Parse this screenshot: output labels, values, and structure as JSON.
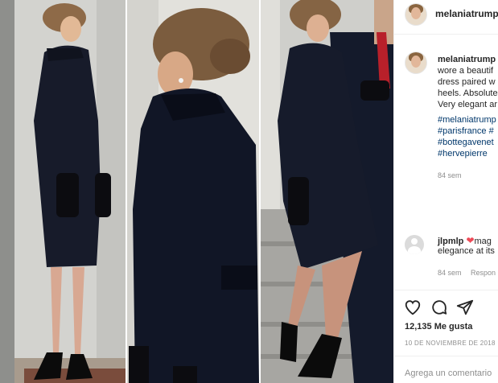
{
  "post": {
    "image_alt": "Photo collage of a woman in a navy coat dress",
    "header_username": "melaniatrump.",
    "caption_lines": [
      {
        "user": "melaniatrump",
        "text": ""
      },
      {
        "user": "",
        "text": "wore a beautif"
      },
      {
        "user": "",
        "text": "dress paired w"
      },
      {
        "user": "",
        "text": "heels. Absolute"
      },
      {
        "user": "",
        "text": "Very elegant ar"
      }
    ],
    "hashtags": [
      "#melaniatrump",
      "#parisfrance #",
      "#bottegavenet",
      "#hervepierre"
    ],
    "caption_time": "84 sem",
    "comment": {
      "user": "jlpmlp",
      "text_after_heart": "mag",
      "line2": "elegance at its",
      "time": "84 sem",
      "reply_label": "Respon"
    },
    "likes_text": "12,135 Me gusta",
    "date_text": "10 DE NOVIEMBRE DE 2018",
    "comment_placeholder": "Agrega un comentario"
  },
  "icons": [
    "heart-icon",
    "comment-icon",
    "share-icon"
  ]
}
